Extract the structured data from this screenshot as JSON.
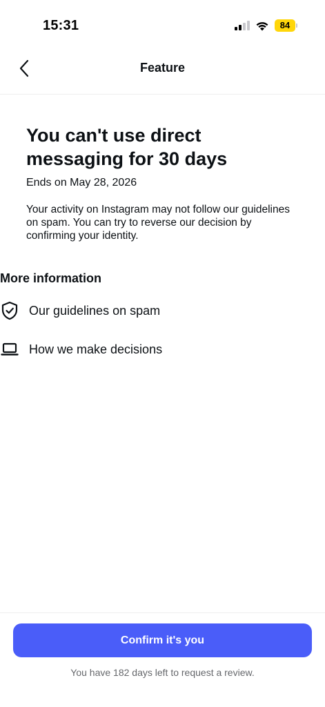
{
  "status_bar": {
    "time": "15:31",
    "battery_level": "84",
    "signal_bars_filled": 2,
    "signal_bars_total": 4,
    "battery_color": "#ffd60a"
  },
  "header": {
    "back_icon": "chevron-left-icon",
    "title": "Feature"
  },
  "main": {
    "headline": "You can't use direct messaging for 30 days",
    "ends_on": "Ends on May 28, 2026",
    "description": "Your activity on Instagram may not follow our guidelines on spam. You can try to reverse our decision by confirming your identity."
  },
  "more_info": {
    "heading": "More information",
    "items": [
      {
        "icon": "shield-check-icon",
        "label": "Our guidelines on spam"
      },
      {
        "icon": "laptop-icon",
        "label": "How we make decisions"
      }
    ]
  },
  "footer": {
    "confirm_label": "Confirm it's you",
    "review_note": "You have 182 days left to request a review.",
    "accent_color": "#4a5df9"
  }
}
